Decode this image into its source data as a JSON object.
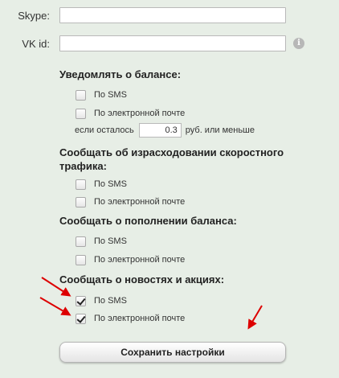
{
  "contacts": {
    "skype_label": "Skype:",
    "skype_value": "",
    "vk_label": "VK id:",
    "vk_value": ""
  },
  "sections": [
    {
      "heading": "Уведомлять о балансе:",
      "options": [
        {
          "label": "По SMS",
          "checked": false
        },
        {
          "label": "По электронной почте",
          "checked": false
        }
      ],
      "threshold": {
        "prefix": "если осталось",
        "value": "0.3",
        "suffix": "руб. или меньше"
      }
    },
    {
      "heading": "Сообщать об израсходовании скоростного трафика:",
      "options": [
        {
          "label": "По SMS",
          "checked": false
        },
        {
          "label": "По электронной почте",
          "checked": false
        }
      ]
    },
    {
      "heading": "Сообщать о пополнении баланса:",
      "options": [
        {
          "label": "По SMS",
          "checked": false
        },
        {
          "label": "По электронной почте",
          "checked": false
        }
      ]
    },
    {
      "heading": "Сообщать о новостях и акциях:",
      "options": [
        {
          "label": "По SMS",
          "checked": true
        },
        {
          "label": "По электронной почте",
          "checked": true
        }
      ]
    }
  ],
  "save_label": "Сохранить настройки",
  "icons": {
    "info": "info-icon",
    "annotation_arrow": "red-arrow-icon"
  },
  "colors": {
    "background": "#e7eee6",
    "annotation": "#dd0000"
  }
}
